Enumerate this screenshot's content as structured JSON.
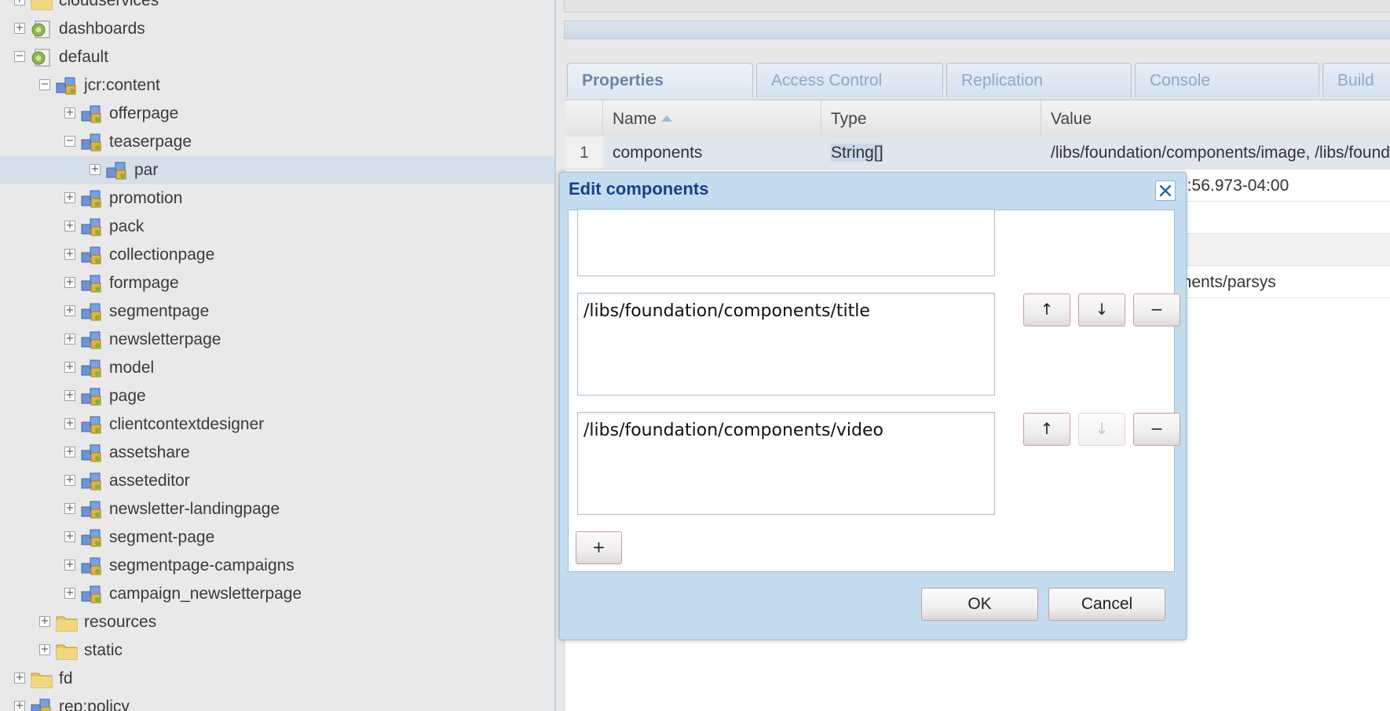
{
  "tree": {
    "items": [
      {
        "label": "cloudservices",
        "expanded": false,
        "icon": "folder-icon",
        "selected": false
      },
      {
        "label": "dashboards",
        "expanded": false,
        "icon": "page-node-icon",
        "selected": false
      },
      {
        "label": "default",
        "expanded": true,
        "icon": "page-node-icon",
        "selected": false
      },
      {
        "label": "jcr:content",
        "expanded": true,
        "icon": "component-node-icon",
        "selected": false
      },
      {
        "label": "offerpage",
        "expanded": false,
        "icon": "component-node-icon",
        "selected": false
      },
      {
        "label": "teaserpage",
        "expanded": true,
        "icon": "component-node-icon",
        "selected": false
      },
      {
        "label": "par",
        "expanded": false,
        "icon": "component-node-icon",
        "selected": true
      },
      {
        "label": "promotion",
        "expanded": false,
        "icon": "component-node-icon",
        "selected": false
      },
      {
        "label": "pack",
        "expanded": false,
        "icon": "component-node-icon",
        "selected": false
      },
      {
        "label": "collectionpage",
        "expanded": false,
        "icon": "component-node-icon",
        "selected": false
      },
      {
        "label": "formpage",
        "expanded": false,
        "icon": "component-node-icon",
        "selected": false
      },
      {
        "label": "segmentpage",
        "expanded": false,
        "icon": "component-node-icon",
        "selected": false
      },
      {
        "label": "newsletterpage",
        "expanded": false,
        "icon": "component-node-icon",
        "selected": false
      },
      {
        "label": "model",
        "expanded": false,
        "icon": "component-node-icon",
        "selected": false
      },
      {
        "label": "page",
        "expanded": false,
        "icon": "component-node-icon",
        "selected": false
      },
      {
        "label": "clientcontextdesigner",
        "expanded": false,
        "icon": "component-node-icon",
        "selected": false
      },
      {
        "label": "assetshare",
        "expanded": false,
        "icon": "component-node-icon",
        "selected": false
      },
      {
        "label": "asseteditor",
        "expanded": false,
        "icon": "component-node-icon",
        "selected": false
      },
      {
        "label": "newsletter-landingpage",
        "expanded": false,
        "icon": "component-node-icon",
        "selected": false
      },
      {
        "label": "segment-page",
        "expanded": false,
        "icon": "component-node-icon",
        "selected": false
      },
      {
        "label": "segmentpage-campaigns",
        "expanded": false,
        "icon": "component-node-icon",
        "selected": false
      },
      {
        "label": "campaign_newsletterpage",
        "expanded": false,
        "icon": "component-node-icon",
        "selected": false
      },
      {
        "label": "resources",
        "expanded": false,
        "icon": "folder-icon",
        "selected": false
      },
      {
        "label": "static",
        "expanded": false,
        "icon": "folder-icon",
        "selected": false
      },
      {
        "label": "fd",
        "expanded": false,
        "icon": "folder-icon",
        "selected": false
      },
      {
        "label": "rep:policy",
        "expanded": false,
        "icon": "component-node-icon",
        "selected": false
      }
    ]
  },
  "tabs": [
    {
      "label": "Properties",
      "active": true
    },
    {
      "label": "Access Control",
      "active": false
    },
    {
      "label": "Replication",
      "active": false
    },
    {
      "label": "Console",
      "active": false
    },
    {
      "label": "Build",
      "active": false
    }
  ],
  "grid": {
    "columns": {
      "name": "Name",
      "type": "Type",
      "value": "Value"
    },
    "rows": [
      {
        "num": "1",
        "name": "components",
        "type": "String[]",
        "value": "/libs/foundation/components/image, /libs/foundation/components/text"
      }
    ],
    "partial_values": [
      "4:56.973-04:00",
      "onents/parsys"
    ]
  },
  "dialog": {
    "title": "Edit components",
    "fields": [
      {
        "value": ""
      },
      {
        "value": "/libs/foundation/components/title"
      },
      {
        "value": "/libs/foundation/components/video"
      }
    ],
    "move_up_label": "↑",
    "move_down_label": "↓",
    "remove_label": "−",
    "add_label": "+",
    "ok_label": "OK",
    "cancel_label": "Cancel"
  },
  "colors": {
    "accent": "#15428b",
    "dialog_bg": "#c4dcef",
    "selected_row": "#d5dfe9"
  }
}
